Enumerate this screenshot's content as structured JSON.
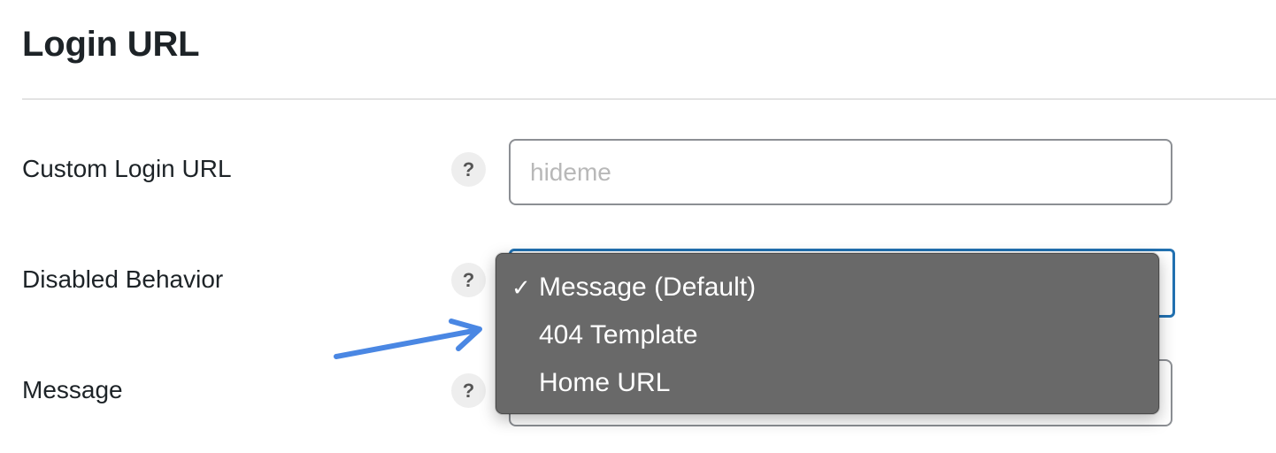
{
  "page": {
    "title": "Login URL"
  },
  "fields": {
    "custom_login_url": {
      "label": "Custom Login URL",
      "help": "?",
      "value": "",
      "placeholder": "hideme"
    },
    "disabled_behavior": {
      "label": "Disabled Behavior",
      "help": "?",
      "selected": "Message (Default)"
    },
    "message": {
      "label": "Message",
      "help": "?",
      "value": ""
    }
  },
  "dropdown": {
    "check_glyph": "✓",
    "options": [
      {
        "label": "Message (Default)",
        "checked": true
      },
      {
        "label": "404 Template",
        "checked": false
      },
      {
        "label": "Home URL",
        "checked": false
      }
    ]
  },
  "annotation": {
    "arrow_color": "#4a87e3"
  },
  "colors": {
    "accent": "#2271b1",
    "dropdown_bg": "#696969"
  }
}
